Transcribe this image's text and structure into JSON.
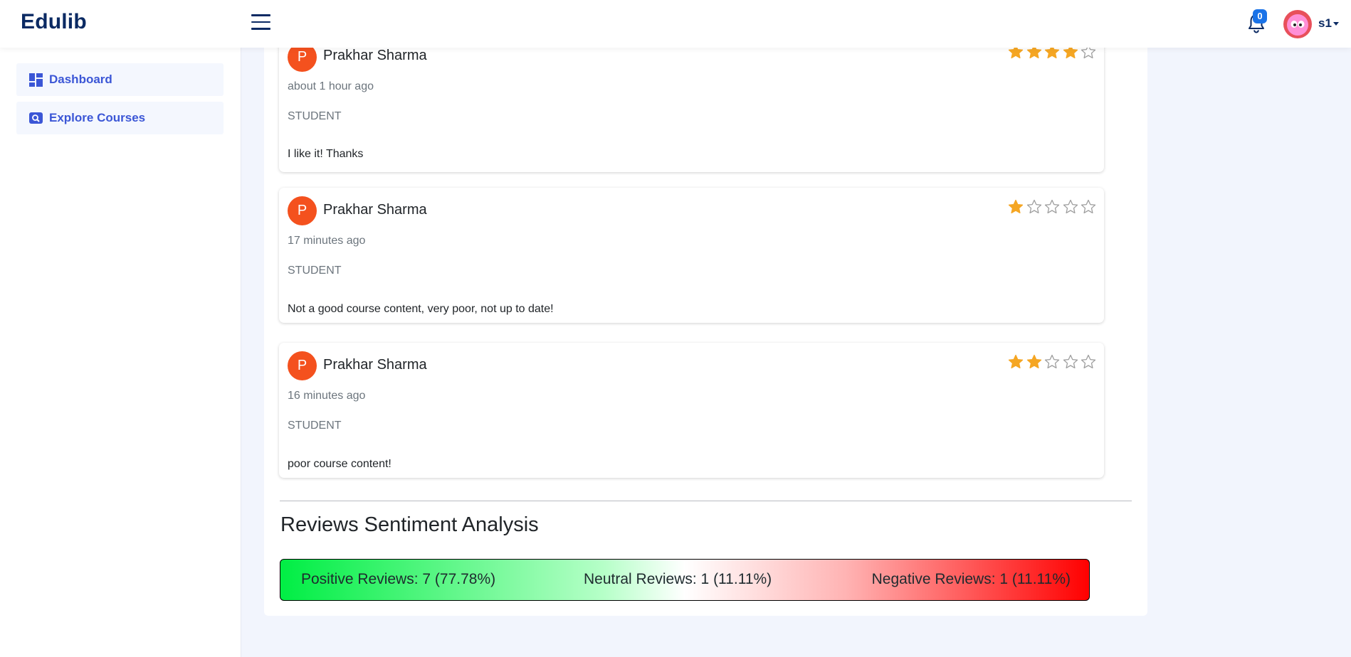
{
  "header": {
    "brand": "Edulib",
    "notification_count": "0",
    "user_name": "s1"
  },
  "sidebar": {
    "items": [
      {
        "label": "Dashboard",
        "icon": "dashboard-icon"
      },
      {
        "label": "Explore Courses",
        "icon": "search-icon"
      }
    ]
  },
  "reviews": [
    {
      "initial": "P",
      "name": "Prakhar Sharma",
      "time": "about 1 hour ago",
      "role": "STUDENT",
      "text": "I like it! Thanks",
      "rating": 4,
      "max": 5
    },
    {
      "initial": "P",
      "name": "Prakhar Sharma",
      "time": "17 minutes ago",
      "role": "STUDENT",
      "text": "Not a good course content, very poor, not up to date!",
      "rating": 1,
      "max": 5
    },
    {
      "initial": "P",
      "name": "Prakhar Sharma",
      "time": "16 minutes ago",
      "role": "STUDENT",
      "text": "poor course content!",
      "rating": 2,
      "max": 5
    }
  ],
  "sentiment": {
    "title": "Reviews Sentiment Analysis",
    "positive": "Positive Reviews: 7 (77.78%)",
    "neutral": "Neutral Reviews: 1 (11.11%)",
    "negative": "Negative Reviews: 1 (11.11%)"
  },
  "colors": {
    "brand": "#0b2a63",
    "accent": "#3b56d6",
    "star_filled": "#f5a623",
    "star_empty": "#9e9e9e",
    "avatar_bg": "#f4511e"
  }
}
